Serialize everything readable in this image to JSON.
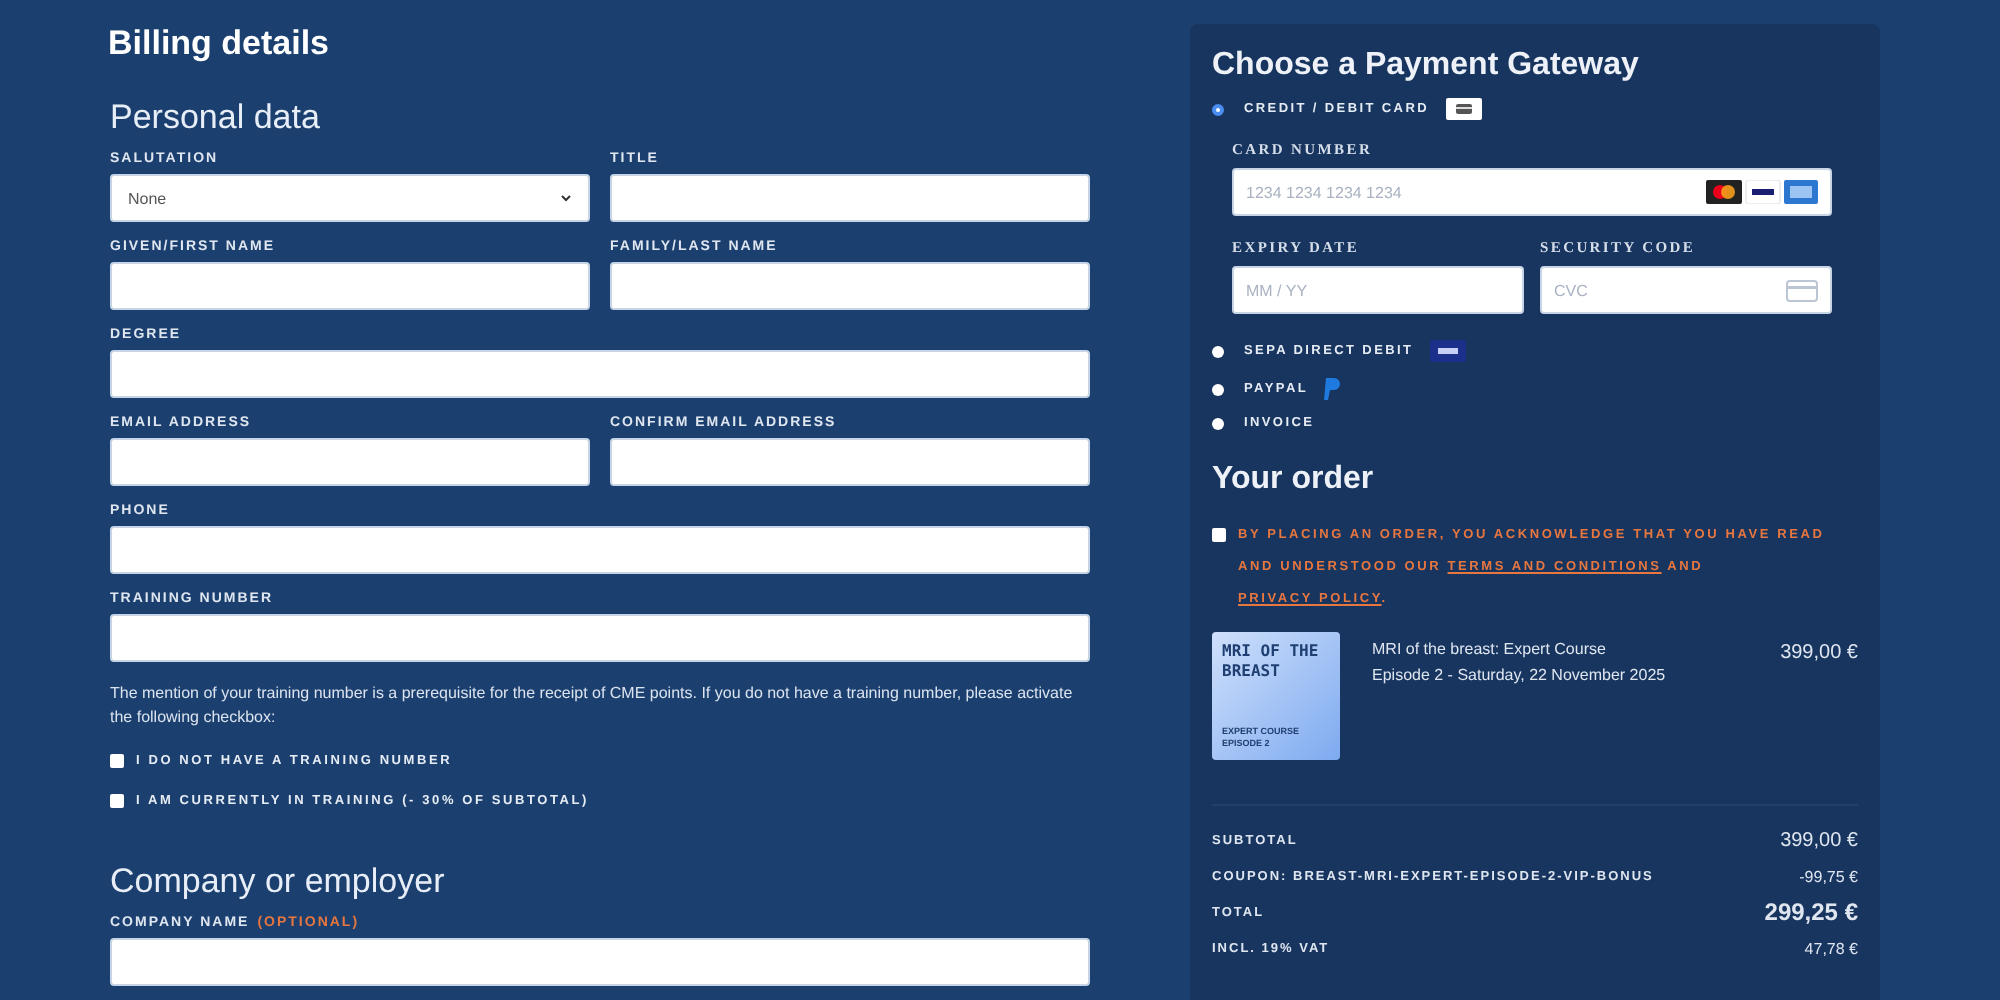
{
  "billing": {
    "title": "Billing details",
    "personal": {
      "heading": "Personal data",
      "rows": [
        [
          {
            "label": "SALUTATION",
            "kind": "select",
            "value": "None"
          },
          {
            "label": "TITLE",
            "kind": "text"
          }
        ],
        [
          {
            "label": "GIVEN/FIRST NAME",
            "kind": "text"
          },
          {
            "label": "FAMILY/LAST NAME",
            "kind": "text"
          }
        ],
        [
          {
            "label": "DEGREE",
            "kind": "text"
          }
        ],
        [
          {
            "label": "EMAIL ADDRESS",
            "kind": "text"
          },
          {
            "label": "CONFIRM EMAIL ADDRESS",
            "kind": "text"
          }
        ],
        [
          {
            "label": "PHONE",
            "kind": "text"
          }
        ],
        [
          {
            "label": "TRAINING NUMBER",
            "kind": "text"
          }
        ]
      ],
      "note": "The mention of your training number is a prerequisite for the receipt of CME points. If you do not have a training number, please activate the following checkbox:",
      "checkboxes": [
        {
          "label": "I DO NOT HAVE A TRAINING NUMBER",
          "checked": false
        },
        {
          "label": "I AM CURRENTLY IN TRAINING (- 30% OF SUBTOTAL)",
          "checked": false
        }
      ]
    },
    "company": {
      "heading": "Company or employer",
      "rows": [
        [
          {
            "label": "COMPANY NAME",
            "optional": "(OPTIONAL)",
            "kind": "text"
          }
        ]
      ]
    }
  },
  "payment": {
    "title": "Choose a Payment Gateway",
    "methods": [
      {
        "label": "CREDIT / DEBIT CARD",
        "selected": true,
        "kind": "card"
      },
      {
        "label": "SEPA DIRECT DEBIT",
        "selected": false,
        "kind": "sepa"
      },
      {
        "label": "PAYPAL",
        "selected": false,
        "kind": "paypal"
      },
      {
        "label": "INVOICE",
        "selected": false,
        "kind": "plain"
      }
    ],
    "card": {
      "number": {
        "label": "CARD NUMBER",
        "placeholder": "1234 1234 1234 1234"
      },
      "expiry": {
        "label": "EXPIRY DATE",
        "placeholder": "MM / YY"
      },
      "cvc": {
        "label": "SECURITY CODE",
        "placeholder": "CVC"
      }
    }
  },
  "order": {
    "title": "Your order",
    "terms": {
      "checked": false,
      "before": "BY PLACING AN ORDER, YOU ACKNOWLEDGE THAT YOU HAVE READ AND UNDERSTOOD OUR",
      "link_1": "TERMS AND CONDITIONS",
      "middle": "AND",
      "link_2": "PRIVACY POLICY",
      "after": "."
    },
    "item": {
      "cover": {
        "title": "MRI OF THE BREAST",
        "subtitle": "EXPERT COURSE EPISODE 2"
      },
      "name": "MRI of the breast: Expert Course",
      "detail": "Episode 2 - Saturday, 22 November 2025",
      "price": "399,00 €"
    },
    "totals": [
      {
        "label": "SUBTOTAL",
        "value": "399,00 €",
        "kind": "subtotal"
      },
      {
        "label": "COUPON: BREAST-MRI-EXPERT-EPISODE-2-VIP-BONUS",
        "value": "-99,75 €",
        "kind": "minor"
      },
      {
        "label": "TOTAL",
        "value": "299,25 €",
        "kind": "total"
      },
      {
        "label": "INCL. 19% VAT",
        "value": "47,78 €",
        "kind": "minor"
      }
    ]
  }
}
